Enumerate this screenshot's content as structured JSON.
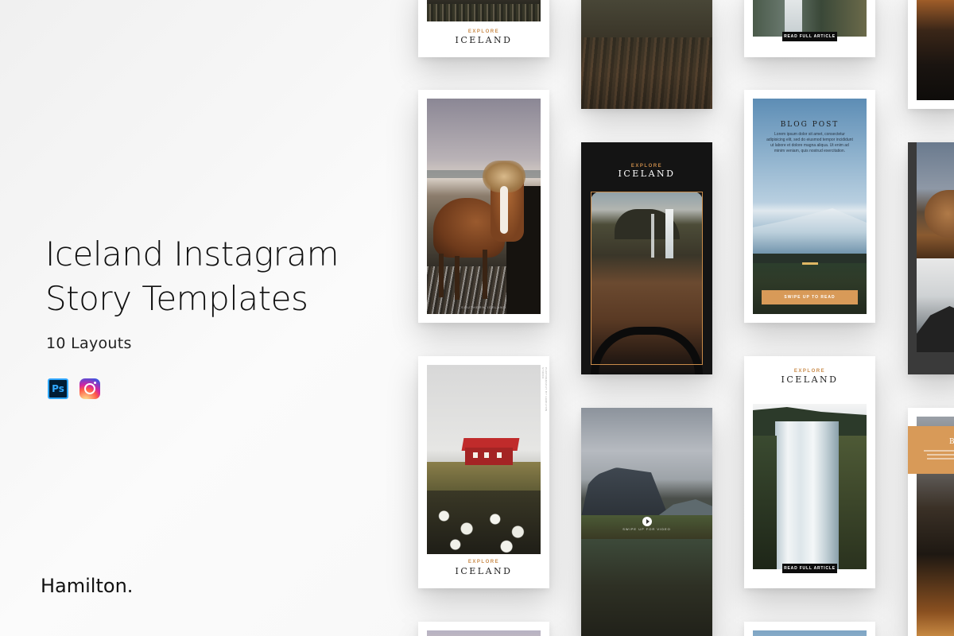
{
  "headline": {
    "line1": "Iceland Instagram",
    "line2": "Story Templates"
  },
  "subtitle": "10 Layouts",
  "app_icons": {
    "photoshop_label": "Ps",
    "photoshop_icon": "photoshop-icon",
    "instagram_icon": "instagram-icon"
  },
  "brand": "Hamilton.",
  "templates": {
    "explore_label": "EXPLORE",
    "iceland_label": "ICELAND",
    "read_full_article": "READ FULL ARTICLE",
    "blog_post_title": "BLOG POST",
    "blog_post_text": "Lorem ipsum dolor sit amet, consectetur adipisicing elit, sed do eiusmod tempor incididunt ut labore et dolore magna aliqua. Ut enim ad minim veniam, quis nostrud exercitation.",
    "swipe_up_to_read": "SWIPE UP TO READ",
    "swipe_up_for_video": "SWIPE UP FOR VIDEO",
    "photo_credit": "SOUTHERN ICELAND",
    "vertical_credit": "PHOTOGRAPHY BY HAMILTON STUDIO"
  },
  "colors": {
    "accent_orange": "#d89a58",
    "accent_gold": "#c98b4a",
    "dark": "#0c0c0c"
  }
}
